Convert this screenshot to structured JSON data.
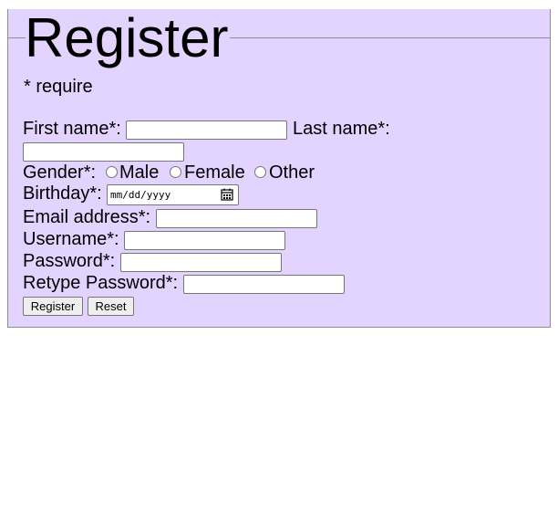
{
  "form": {
    "legend": "Register",
    "require_note": "* require",
    "colors": {
      "background": "#e3d4ff",
      "border": "#8f8f8f"
    },
    "fields": {
      "first_name_label": "First name*:",
      "last_name_label": "Last name*:",
      "gender_label": "Gender*:",
      "gender_options": [
        "Male",
        "Female",
        "Other"
      ],
      "birthday_label": "Birthday*:",
      "birthday_placeholder": "mm/dd/yyyy",
      "email_label": "Email address*:",
      "username_label": "Username*:",
      "password_label": "Password*:",
      "retype_password_label": "Retype Password*:"
    },
    "buttons": {
      "register": "Register",
      "reset": "Reset"
    },
    "icons": {
      "date_picker": "calendar-icon"
    }
  }
}
